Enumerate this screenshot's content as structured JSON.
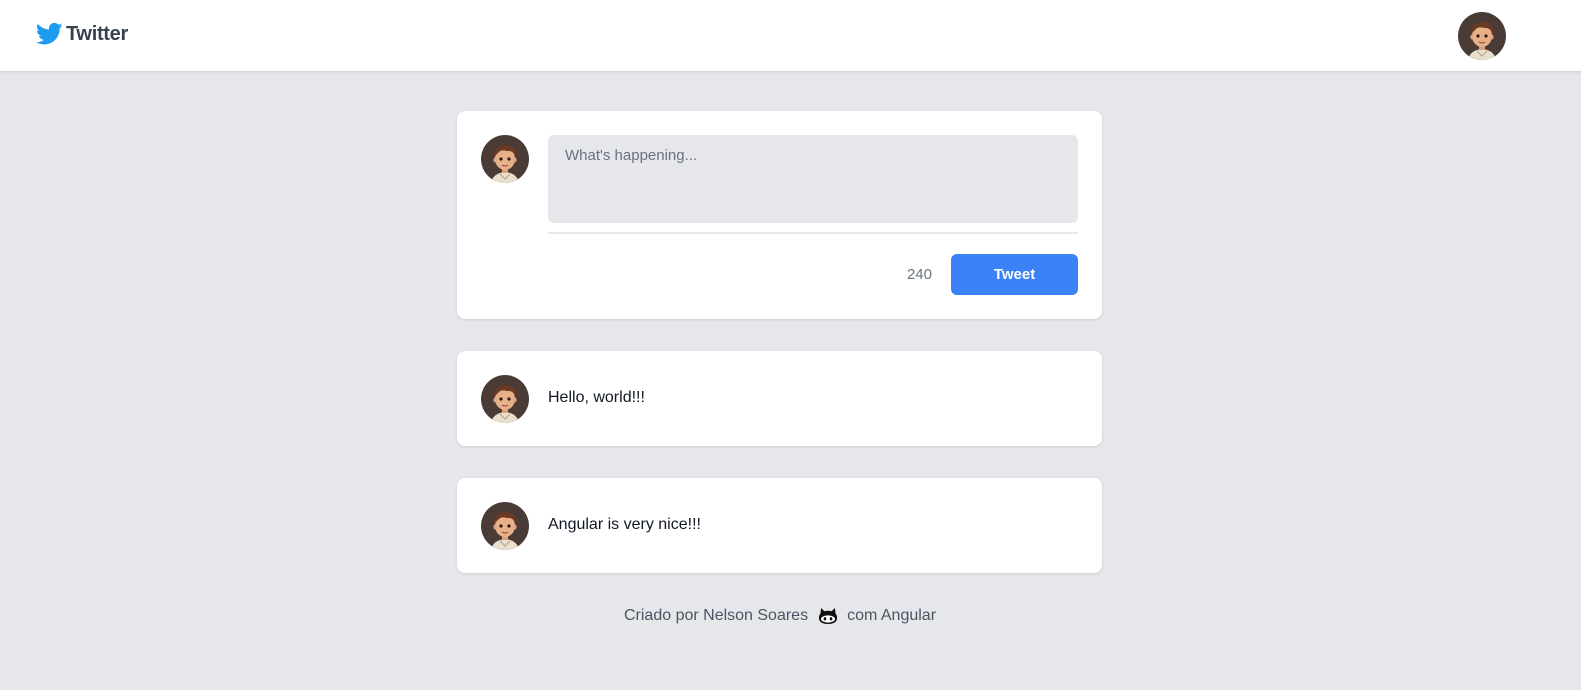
{
  "header": {
    "brand_name": "Twitter",
    "brand_icon": "twitter-bird-icon",
    "user_avatar": "user-avatar"
  },
  "composer": {
    "placeholder": "What's happening...",
    "value": "",
    "char_count": "240",
    "submit_label": "Tweet"
  },
  "posts": [
    {
      "text": "Hello, world!!!"
    },
    {
      "text": "Angular is very nice!!!"
    }
  ],
  "footer": {
    "prefix": "Criado por Nelson Soares",
    "icon": "github-icon",
    "suffix": "com Angular"
  },
  "colors": {
    "background": "#e5e7eb",
    "card": "#ffffff",
    "accent": "#3b82f6",
    "brand_bird": "#1d9bf0",
    "brand_text": "#374151"
  }
}
